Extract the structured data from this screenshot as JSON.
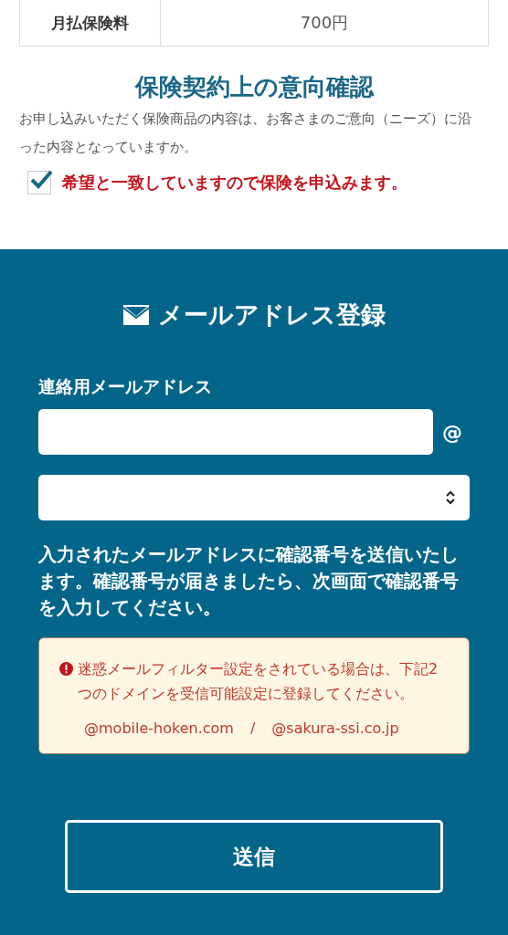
{
  "summary_table": {
    "rows": [
      {
        "label": "月払保険料",
        "value": "700円"
      }
    ]
  },
  "intent": {
    "title": "保険契約上の意向確認",
    "question": "お申し込みいただく保険商品の内容は、お客さまのご意向（ニーズ）に沿った内容となっていますか。",
    "confirmation": {
      "label": "希望と一致していますので保険を申込みます。",
      "checked": true
    }
  },
  "email_section": {
    "title": "メールアドレス登録",
    "field_label": "連絡用メールアドレス",
    "at_sign": "@",
    "description": "入力されたメールアドレスに確認番号を送信いたします。確認番号が届きましたら、次画面で確認番号を入力してください。",
    "notice": {
      "text": "迷惑メールフィルター設定をされている場合は、下記2つのドメインを受信可能設定に登録してください。",
      "domains": [
        "@mobile-hoken.com",
        "@sakura-ssi.co.jp"
      ],
      "separator": "/"
    },
    "submit": "送信"
  }
}
